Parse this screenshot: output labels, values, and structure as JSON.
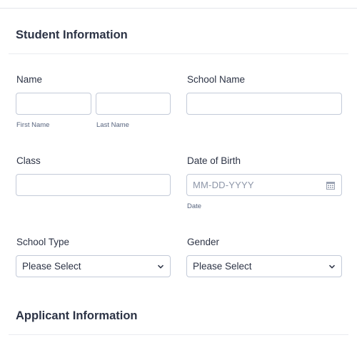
{
  "sections": {
    "student": {
      "title": "Student Information"
    },
    "applicant": {
      "title": "Applicant Information"
    }
  },
  "fields": {
    "name": {
      "label": "Name",
      "first_sublabel": "First Name",
      "last_sublabel": "Last Name",
      "first_value": "",
      "last_value": ""
    },
    "school_name": {
      "label": "School Name",
      "value": ""
    },
    "class": {
      "label": "Class",
      "value": ""
    },
    "date_of_birth": {
      "label": "Date of Birth",
      "placeholder": "MM-DD-YYYY",
      "sublabel": "Date"
    },
    "school_type": {
      "label": "School Type",
      "selected": "Please Select"
    },
    "gender": {
      "label": "Gender",
      "selected": "Please Select"
    }
  },
  "icons": {
    "calendar": "calendar-icon",
    "chevron": "chevron-down-icon"
  },
  "colors": {
    "border": "#c3cad8",
    "text": "#2c3345",
    "placeholder": "#8d96a8"
  }
}
